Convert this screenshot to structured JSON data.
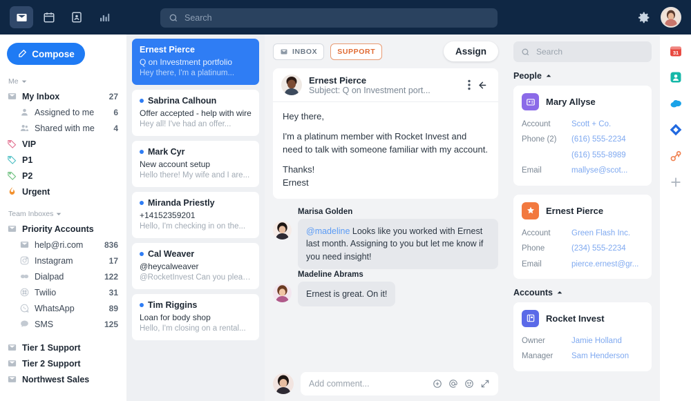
{
  "topbar": {
    "nav_icons": [
      {
        "name": "inbox-icon",
        "label": "Inbox"
      },
      {
        "name": "calendar-icon",
        "label": "Calendar"
      },
      {
        "name": "contacts-icon",
        "label": "Contacts"
      },
      {
        "name": "analytics-icon",
        "label": "Analytics"
      }
    ],
    "search_placeholder": "Search",
    "settings_label": "Settings",
    "avatar_label": "Account"
  },
  "sidebar": {
    "compose_label": "Compose",
    "section_me": "Me",
    "me_items": [
      {
        "label": "My Inbox",
        "count": "27",
        "icon": "inbox-icon",
        "bold": true,
        "sub": false
      },
      {
        "label": "Assigned to me",
        "count": "6",
        "icon": "person-icon",
        "bold": false,
        "sub": true
      },
      {
        "label": "Shared with me",
        "count": "4",
        "icon": "people-icon",
        "bold": false,
        "sub": true
      },
      {
        "label": "VIP",
        "count": "",
        "icon": "tag-icon",
        "color": "#e2708f",
        "bold": true,
        "sub": false
      },
      {
        "label": "P1",
        "count": "",
        "icon": "tag-icon",
        "color": "#4dbfc4",
        "bold": true,
        "sub": false
      },
      {
        "label": "P2",
        "count": "",
        "icon": "tag-icon",
        "color": "#6bbf7d",
        "bold": true,
        "sub": false
      },
      {
        "label": "Urgent",
        "count": "",
        "icon": "flame-icon",
        "color": "#f2912f",
        "bold": true,
        "sub": false
      }
    ],
    "section_team": "Team Inboxes",
    "team_items": [
      {
        "label": "Priority Accounts",
        "count": "",
        "icon": "inbox-icon",
        "bold": true,
        "sub": false
      },
      {
        "label": "help@ri.com",
        "count": "836",
        "icon": "mail-icon",
        "bold": false,
        "sub": true
      },
      {
        "label": "Instagram",
        "count": "17",
        "icon": "instagram-icon",
        "bold": false,
        "sub": true
      },
      {
        "label": "Dialpad",
        "count": "122",
        "icon": "dialpad-icon",
        "bold": false,
        "sub": true
      },
      {
        "label": "Twilio",
        "count": "31",
        "icon": "twilio-icon",
        "bold": false,
        "sub": true
      },
      {
        "label": "WhatsApp",
        "count": "89",
        "icon": "whatsapp-icon",
        "bold": false,
        "sub": true
      },
      {
        "label": "SMS",
        "count": "125",
        "icon": "sms-icon",
        "bold": false,
        "sub": true
      }
    ],
    "other_items": [
      {
        "label": "Tier 1 Support",
        "count": "",
        "icon": "inbox-icon",
        "bold": true,
        "sub": false
      },
      {
        "label": "Tier 2 Support",
        "count": "",
        "icon": "inbox-icon",
        "bold": true,
        "sub": false
      },
      {
        "label": "Northwest Sales",
        "count": "",
        "icon": "inbox-icon",
        "bold": true,
        "sub": false
      }
    ]
  },
  "conversations": [
    {
      "name": "Ernest Pierce",
      "subject": "Q on Investment portfolio",
      "preview": "Hey there, I'm a platinum...",
      "selected": true
    },
    {
      "name": "Sabrina Calhoun",
      "subject": "Offer accepted - help with wire",
      "preview": "Hey all! I've had an offer...",
      "selected": false
    },
    {
      "name": "Mark Cyr",
      "subject": "New account setup",
      "preview": "Hello there! My wife and I are...",
      "selected": false
    },
    {
      "name": "Miranda Priestly",
      "subject": "+14152359201",
      "preview": "Hello, I'm checking in on the...",
      "selected": false
    },
    {
      "name": "Cal Weaver",
      "subject": "@heycalweaver",
      "preview": "@RocketInvest Can you pleas...",
      "selected": false
    },
    {
      "name": "Tim Riggins",
      "subject": "Loan for body shop",
      "preview": "Hello, I'm closing on a rental...",
      "selected": false
    }
  ],
  "message": {
    "tag_inbox": "INBOX",
    "tag_support": "SUPPORT",
    "assign_label": "Assign",
    "sender": "Ernest Pierce",
    "subject_line": "Subject: Q on Investment port...",
    "paragraphs": [
      "Hey there,",
      "I'm a platinum member with Rocket Invest and need to talk with someone familiar with my account.",
      "Thanks!\nErnest"
    ],
    "comments": [
      {
        "author": "Marisa Golden",
        "mention": "@madeline",
        "text": " Looks like you worked with Ernest last month. Assigning to you but let me know if you need insight!"
      },
      {
        "author": "Madeline Abrams",
        "mention": "",
        "text": "Ernest is great. On it!"
      }
    ],
    "comment_placeholder": "Add comment...",
    "comment_icons": [
      "plus-circle-icon",
      "mention-icon",
      "emoji-icon",
      "expand-icon"
    ]
  },
  "rightpanel": {
    "search_placeholder": "Search",
    "people_label": "People",
    "accounts_label": "Accounts",
    "people": [
      {
        "name": "Mary Allyse",
        "icon_color": "#8b6ae8",
        "icon": "contact-card-icon",
        "fields": [
          {
            "key": "Account",
            "values": [
              "Scott + Co."
            ]
          },
          {
            "key": "Phone (2)",
            "values": [
              "(616) 555-2234",
              "(616) 555-8989"
            ]
          },
          {
            "key": "Email",
            "values": [
              "mallyse@scot..."
            ]
          }
        ]
      },
      {
        "name": "Ernest Pierce",
        "icon_color": "#f2793f",
        "icon": "star-badge-icon",
        "fields": [
          {
            "key": "Account",
            "values": [
              "Green Flash Inc."
            ]
          },
          {
            "key": "Phone",
            "values": [
              "(234) 555-2234"
            ]
          },
          {
            "key": "Email",
            "values": [
              "pierce.ernest@gr..."
            ]
          }
        ]
      }
    ],
    "accounts": [
      {
        "name": "Rocket Invest",
        "icon_color": "#5b6ae8",
        "icon": "building-icon",
        "fields": [
          {
            "key": "Owner",
            "values": [
              "Jamie Holland"
            ]
          },
          {
            "key": "Manager",
            "values": [
              "Sam Henderson"
            ]
          }
        ]
      }
    ]
  },
  "rail": {
    "icons": [
      {
        "name": "calendar-app-icon",
        "color": "#e8483f"
      },
      {
        "name": "contacts-app-icon",
        "color": "#16b8a8"
      },
      {
        "name": "salesforce-app-icon",
        "color": "#1aa3e8"
      },
      {
        "name": "jira-app-icon",
        "color": "#2169e0"
      },
      {
        "name": "hubspot-app-icon",
        "color": "#f08150"
      },
      {
        "name": "add-app-icon",
        "color": "#a9b2bc"
      }
    ]
  },
  "colors": {
    "topbar_bg": "#0f2744",
    "accent_blue": "#2f7df4",
    "support_orange": "#e06a32",
    "link_blue": "#7fa9f0"
  }
}
